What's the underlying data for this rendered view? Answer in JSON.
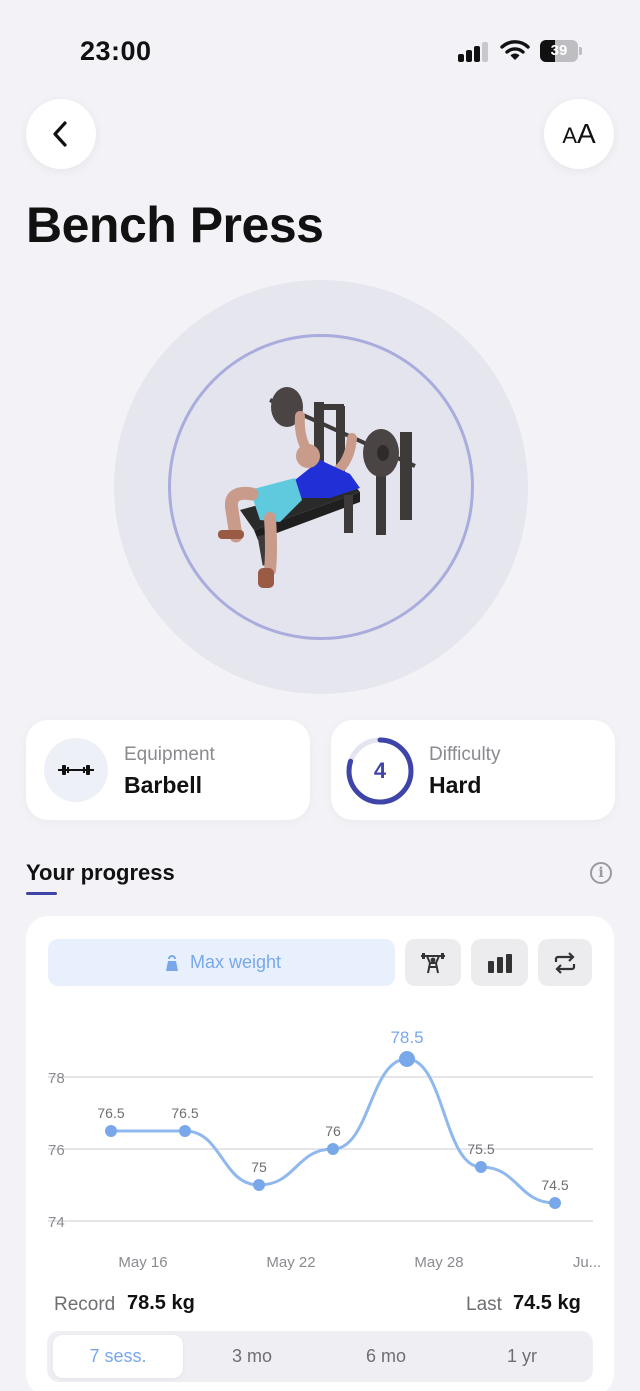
{
  "status_bar": {
    "time": "23:00",
    "battery": "39",
    "battery_level": 0.39
  },
  "header": {
    "back_icon": "chevron-left-icon",
    "font_size_icon": "text-size-icon",
    "font_size_label_small": "A",
    "font_size_label_large": "A"
  },
  "exercise": {
    "title": "Bench Press"
  },
  "equipment": {
    "label": "Equipment",
    "value": "Barbell",
    "icon": "barbell-icon"
  },
  "difficulty": {
    "label": "Difficulty",
    "value": "Hard",
    "level": "4",
    "level_fraction": 0.8
  },
  "progress": {
    "title": "Your progress",
    "metric_tabs": [
      {
        "label": "Max weight",
        "icon": "kettlebell-icon",
        "active": true
      },
      {
        "icon": "person-lifting-icon"
      },
      {
        "icon": "bar-chart-icon"
      },
      {
        "icon": "repeat-icon"
      }
    ],
    "record_label": "Record",
    "record_value": "78.5 kg",
    "last_label": "Last",
    "last_value": "74.5 kg",
    "ranges": [
      {
        "label": "7 sess.",
        "active": true
      },
      {
        "label": "3 mo"
      },
      {
        "label": "6 mo"
      },
      {
        "label": "1 yr"
      }
    ]
  },
  "colors": {
    "accent": "#3f45a8",
    "chart_line": "#8fb8ee",
    "chart_point": "#79a8ea"
  },
  "chart_data": {
    "type": "line",
    "x_tick_labels": [
      "May 16",
      "May 22",
      "May 28",
      "Ju..."
    ],
    "yticks": [
      74,
      76,
      78
    ],
    "ylim": [
      74,
      78.5
    ],
    "values": [
      76.5,
      76.5,
      75,
      76,
      78.5,
      75.5,
      74.5
    ],
    "point_labels": [
      "76.5",
      "76.5",
      "75",
      "76",
      "78.5",
      "75.5",
      "74.5"
    ],
    "highlight_index": 4,
    "grid": true
  }
}
